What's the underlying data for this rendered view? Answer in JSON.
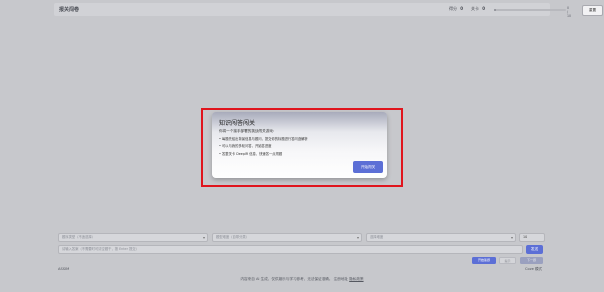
{
  "header": {
    "title": "报关闯卷",
    "score_label": "得分",
    "score_value": "0",
    "level_label": "关卡",
    "level_value": "0",
    "progress_fraction": 0.03,
    "progress_text": "0 / 10",
    "reset_label": "重置"
  },
  "modal": {
    "title": "知识闯答闯关",
    "intro": "你将一个接手部署的挑战闯关游戏：",
    "items": [
      "• 每题先给出背景信息与题问，提交你的标题进行答问逐解析",
      "• 可以与我的多轮问答，开始答进度",
      "• 答整关卡 DeepIR 信息，快速答一点闯题"
    ],
    "start_label": "开始闯关"
  },
  "form": {
    "select1_placeholder": "题序类型（不适选择）",
    "select2_placeholder": "题型难度（自带分类）",
    "select3_placeholder": "选择难度",
    "number_value": "10",
    "answer_placeholder": "请输入答案（不需要时可清空题干，按 Enter 提交）",
    "send_label": "发送",
    "help_label": "开始答题",
    "hint_label": "提示",
    "next_label": "下一题"
  },
  "status": {
    "left": "ASSIM",
    "right": "Coze 模式"
  },
  "footer": {
    "text": "内容来自 AI 生成，仅供娱乐与学习参考，无法保证准确。 注册地址",
    "link": "隐私政策"
  }
}
